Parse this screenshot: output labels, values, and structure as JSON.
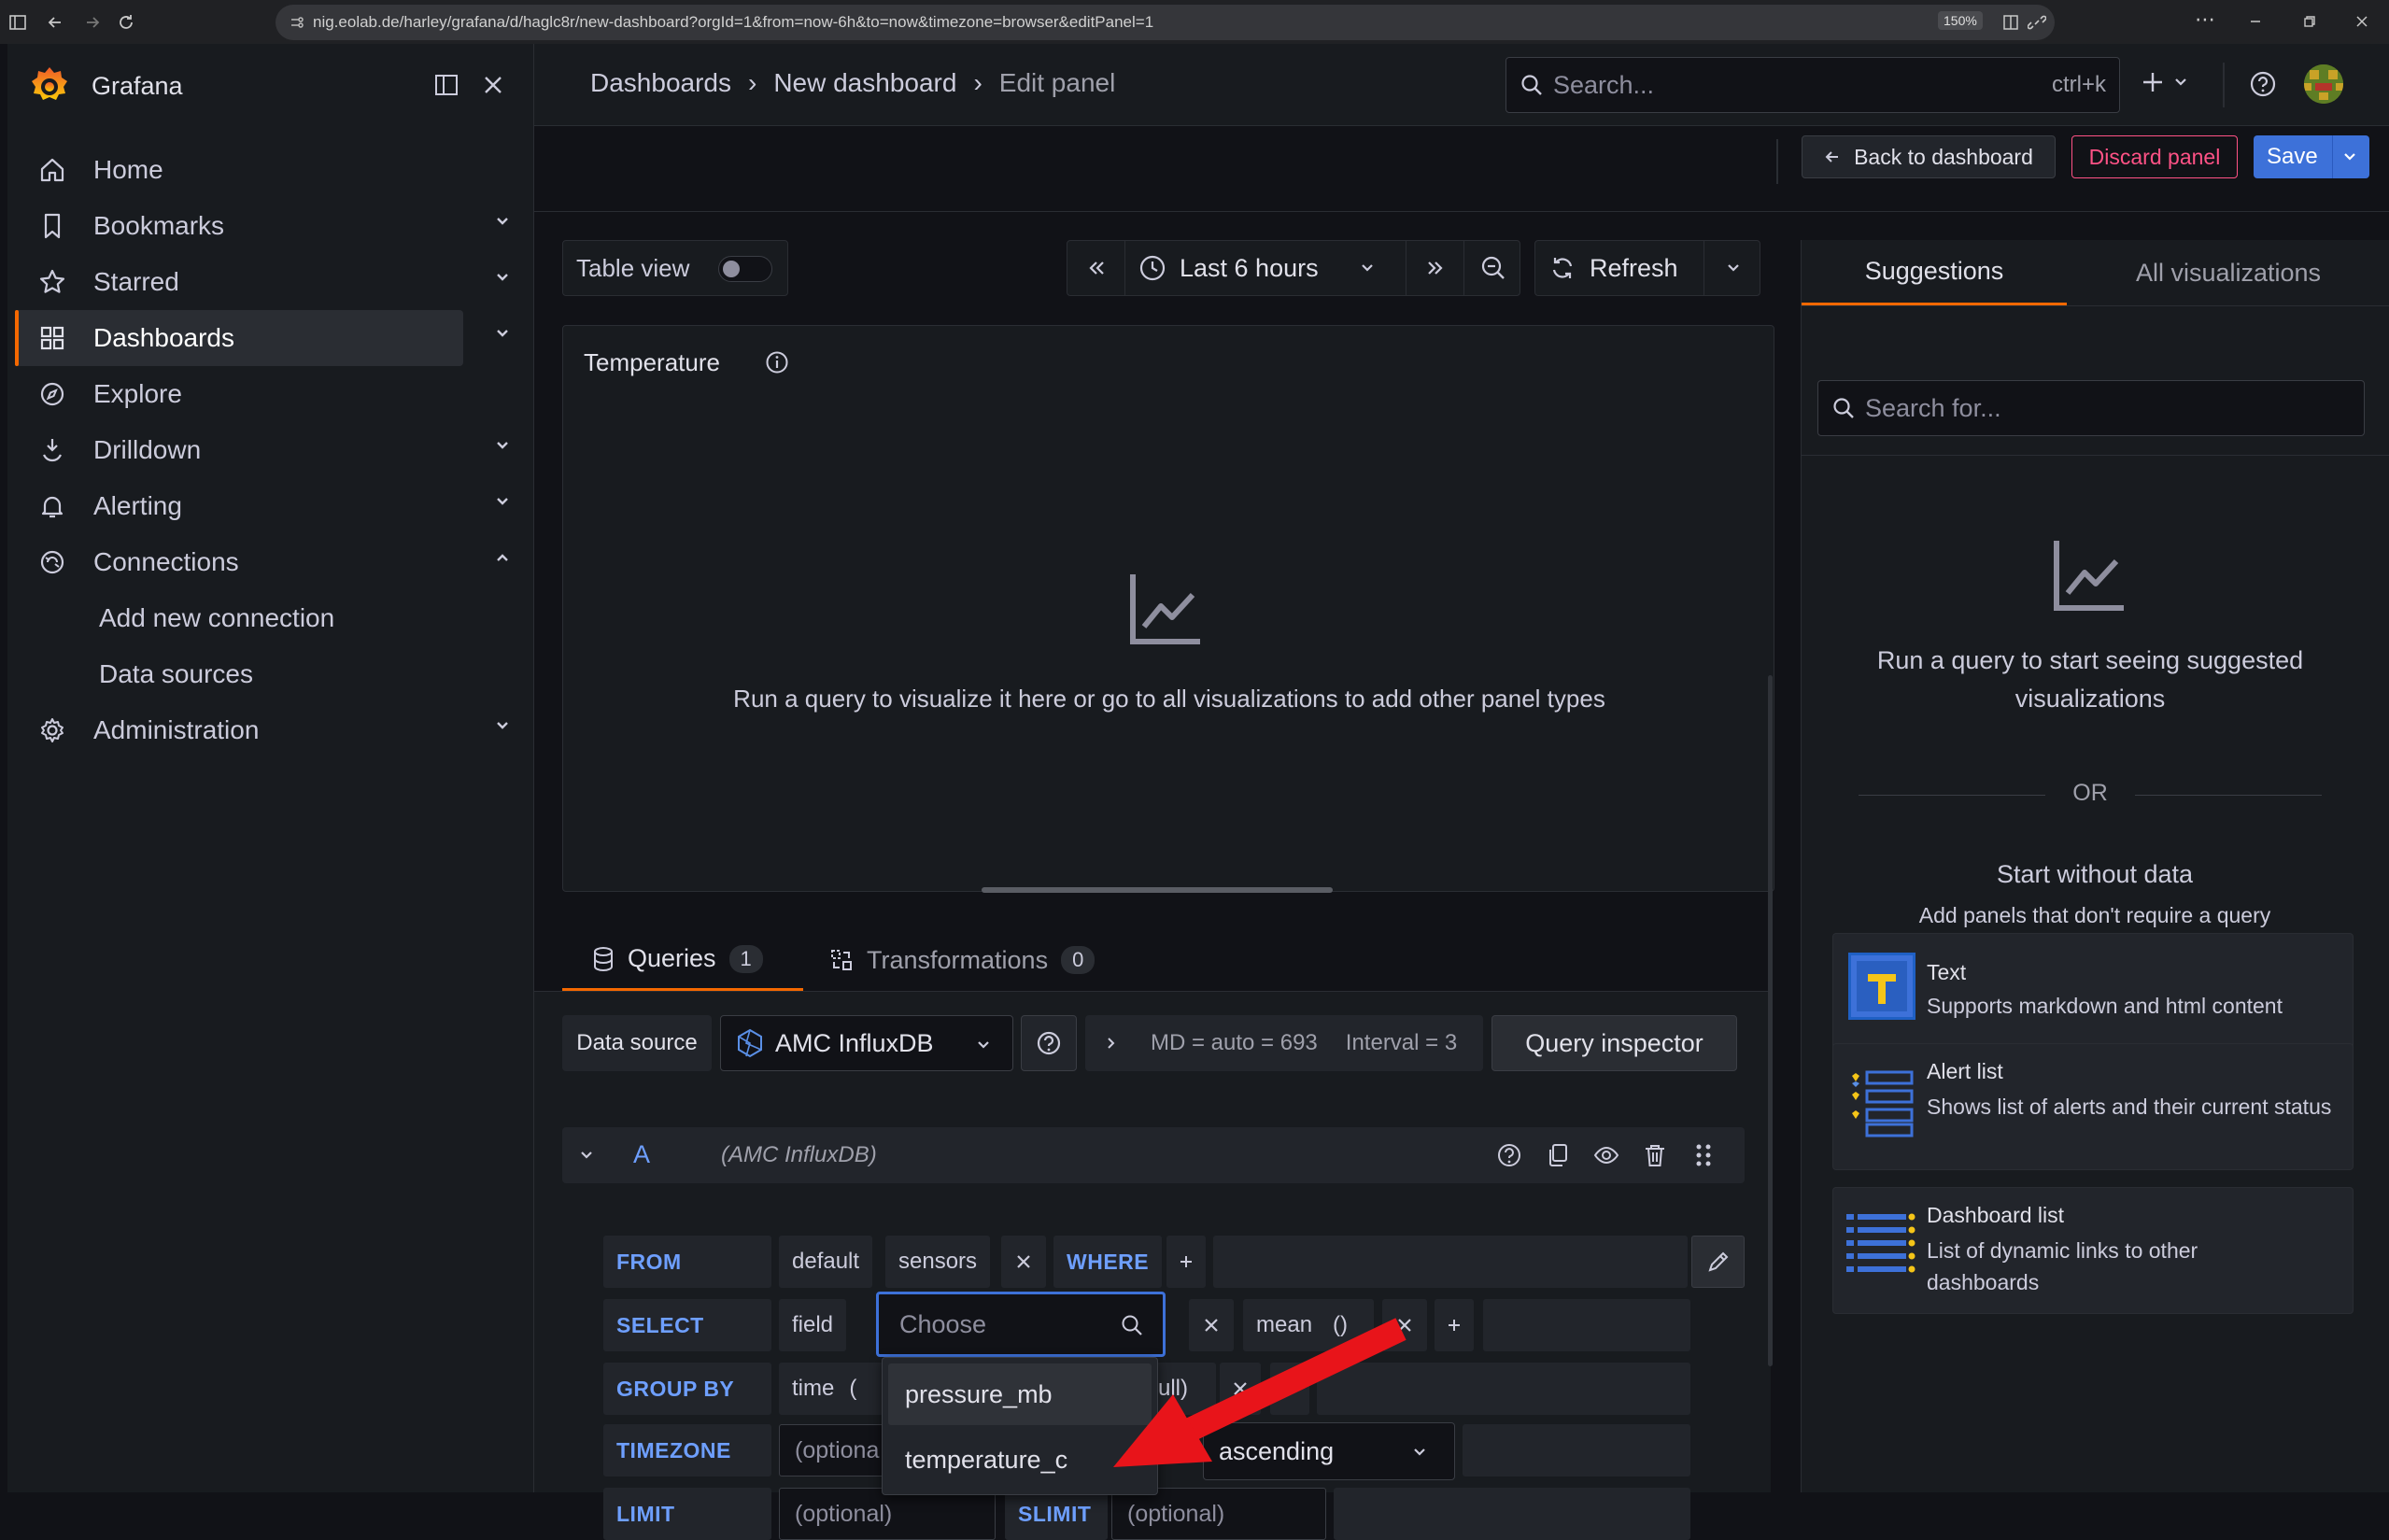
{
  "browser": {
    "url": "nig.eolab.de/harley/grafana/d/haglc8r/new-dashboard?orgId=1&from=now-6h&to=now&timezone=browser&editPanel=1",
    "zoom": "150%"
  },
  "sidebar": {
    "brand": "Grafana",
    "items": [
      {
        "label": "Home",
        "icon": "home-icon"
      },
      {
        "label": "Bookmarks",
        "icon": "bookmark-icon"
      },
      {
        "label": "Starred",
        "icon": "star-icon"
      },
      {
        "label": "Dashboards",
        "icon": "apps-icon"
      },
      {
        "label": "Explore",
        "icon": "compass-icon"
      },
      {
        "label": "Drilldown",
        "icon": "drilldown-icon"
      },
      {
        "label": "Alerting",
        "icon": "bell-icon"
      },
      {
        "label": "Connections",
        "icon": "connections-icon"
      },
      {
        "label": "Add new connection"
      },
      {
        "label": "Data sources"
      },
      {
        "label": "Administration",
        "icon": "cog-icon"
      }
    ]
  },
  "header": {
    "breadcrumb": [
      "Dashboards",
      "New dashboard",
      "Edit panel"
    ],
    "search_placeholder": "Search...",
    "search_shortcut": "ctrl+k"
  },
  "toolbar": {
    "back": "Back to dashboard",
    "discard": "Discard panel",
    "save": "Save"
  },
  "panel_controls": {
    "table_view": "Table view",
    "time_range": "Last 6 hours",
    "refresh": "Refresh"
  },
  "preview": {
    "title": "Temperature",
    "empty_message": "Run a query to visualize it here or go to all visualizations to add other panel types"
  },
  "tabs": {
    "queries": "Queries",
    "queries_count": "1",
    "transformations": "Transformations",
    "transformations_count": "0"
  },
  "datasource": {
    "label": "Data source",
    "name": "AMC InfluxDB",
    "md": "MD = auto = 693",
    "interval": "Interval = 3",
    "inspector": "Query inspector"
  },
  "query": {
    "ref": "A",
    "source": "(AMC InfluxDB)",
    "from_kw": "FROM",
    "from_db": "default",
    "from_measurement": "sensors",
    "where_kw": "WHERE",
    "select_kw": "SELECT",
    "select_field": "field",
    "choose_placeholder": "Choose",
    "mean": "mean",
    "mean_parens": "()",
    "groupby_kw": "GROUP BY",
    "groupby_time": "time",
    "groupby_paren": "(",
    "fill_fragment": "ull)",
    "timezone_kw": "TIMEZONE",
    "optional": "(optional)",
    "optional_short": "(optiona",
    "order": "ascending",
    "limit_kw": "LIMIT",
    "slimit_kw": "SLIMIT"
  },
  "dropdown": {
    "options": [
      "pressure_mb",
      "temperature_c"
    ]
  },
  "viz": {
    "tab_suggestions": "Suggestions",
    "tab_all": "All visualizations",
    "search_placeholder": "Search for...",
    "hint": "Run a query to start seeing suggested visualizations",
    "or": "OR",
    "start_title": "Start without data",
    "start_sub": "Add panels that don't require a query",
    "cards": [
      {
        "title": "Text",
        "desc": "Supports markdown and html content"
      },
      {
        "title": "Alert list",
        "desc": "Shows list of alerts and their current status"
      },
      {
        "title": "Dashboard list",
        "desc": "List of dynamic links to other dashboards"
      }
    ]
  },
  "colors": {
    "accent_orange": "#f46800",
    "primary_blue": "#3d71d9",
    "danger": "#ff5286",
    "keyword_blue": "#6e9fff",
    "arrow_red": "#e8141a"
  }
}
